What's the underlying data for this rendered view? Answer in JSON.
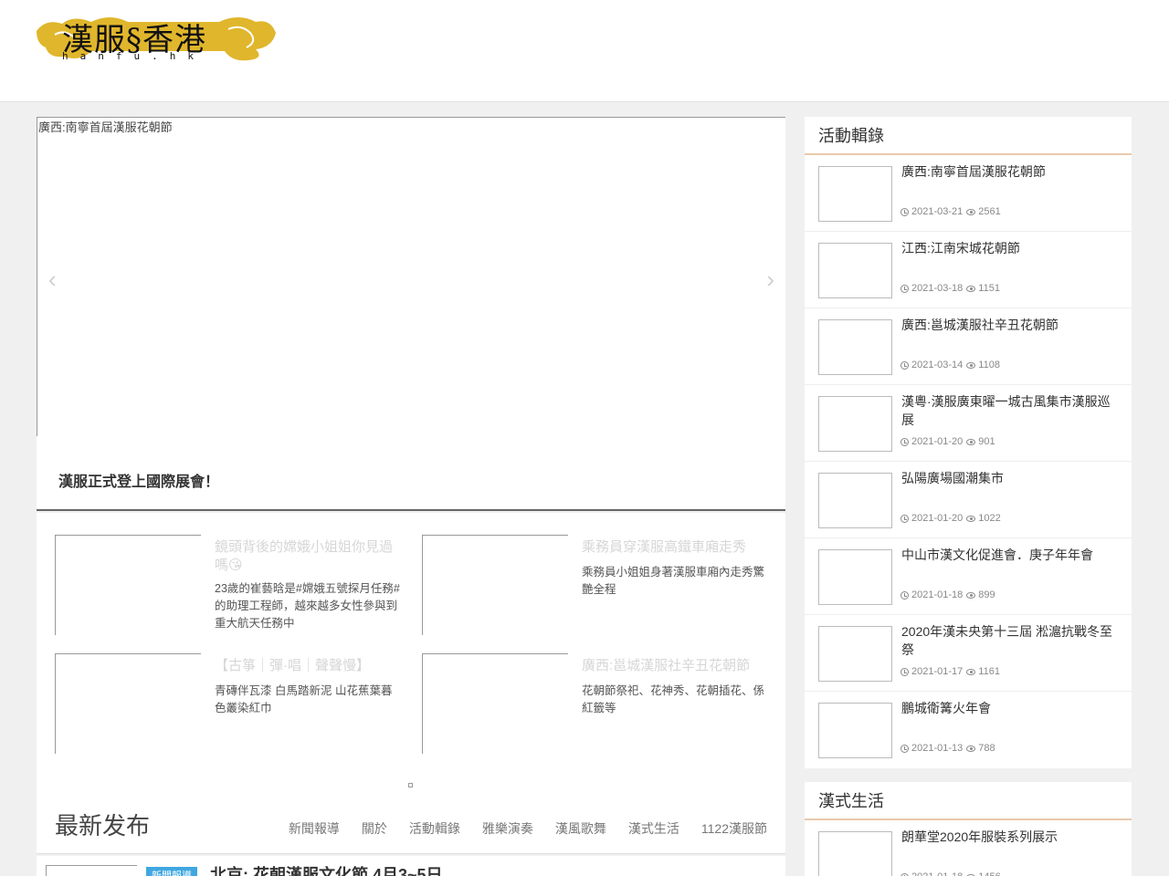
{
  "header": {
    "logo_text": "漢服§香港",
    "logo_subtext": "hanfu.hk"
  },
  "slider": {
    "image_alt": "廣西:南寧首屆漢服花朝節",
    "prev_glyph": "‹",
    "next_glyph": "›",
    "caption": "漢服正式登上國際展會！"
  },
  "featured": [
    {
      "title": "鏡頭背後的嫦娥小姐姐你見過嗎😘",
      "desc": "23歲的崔藝晗是#嫦娥五號探月任務#的助理工程師，越來越多女性參與到重大航天任務中"
    },
    {
      "title": "乘務員穿漢服高鐵車廂走秀",
      "desc": "乘務員小姐姐身著漢服車廂內走秀驚艷全程"
    },
    {
      "title": "【古箏｜彈·唱｜聲聲慢】",
      "desc": "青磚伴瓦漆 白馬踏新泥 山花蕉葉暮色叢染紅巾"
    },
    {
      "title": "廣西:邕城漢服社辛丑花朝節",
      "desc": "花朝節祭祀、花神秀、花朝插花、係紅籤等"
    }
  ],
  "latest": {
    "title": "最新发布",
    "tabs": [
      "新聞報導",
      "關於",
      "活動輯錄",
      "雅樂演奏",
      "漢風歌舞",
      "漢式生活",
      "1122漢服節"
    ],
    "first_post": {
      "badge": "新聞報導",
      "title": "北京: 花朝漢服文化節 4月3~5日"
    }
  },
  "sidebar": {
    "activity": {
      "heading": "活動輯錄",
      "items": [
        {
          "title": "廣西:南寧首屆漢服花朝節",
          "date": "2021-03-21",
          "views": "2561"
        },
        {
          "title": "江西:江南宋城花朝節",
          "date": "2021-03-18",
          "views": "1151"
        },
        {
          "title": "廣西:邕城漢服社辛丑花朝節",
          "date": "2021-03-14",
          "views": "1108"
        },
        {
          "title": "漢粵·漢服廣東曜一城古風集市漢服巡展",
          "date": "2021-01-20",
          "views": "901"
        },
        {
          "title": "弘陽廣場國潮集市",
          "date": "2021-01-20",
          "views": "1022"
        },
        {
          "title": "中山市漢文化促進會．庚子年年會",
          "date": "2021-01-18",
          "views": "899"
        },
        {
          "title": "2020年漢未央第十三屆 淞滬抗戰冬至祭",
          "date": "2021-01-17",
          "views": "1161"
        },
        {
          "title": "鵬城衛篝火年會",
          "date": "2021-01-13",
          "views": "788"
        }
      ]
    },
    "life": {
      "heading": "漢式生活",
      "items": [
        {
          "title": "朗華堂2020年服裝系列展示",
          "date": "2021-01-18",
          "views": "1456"
        }
      ]
    }
  }
}
